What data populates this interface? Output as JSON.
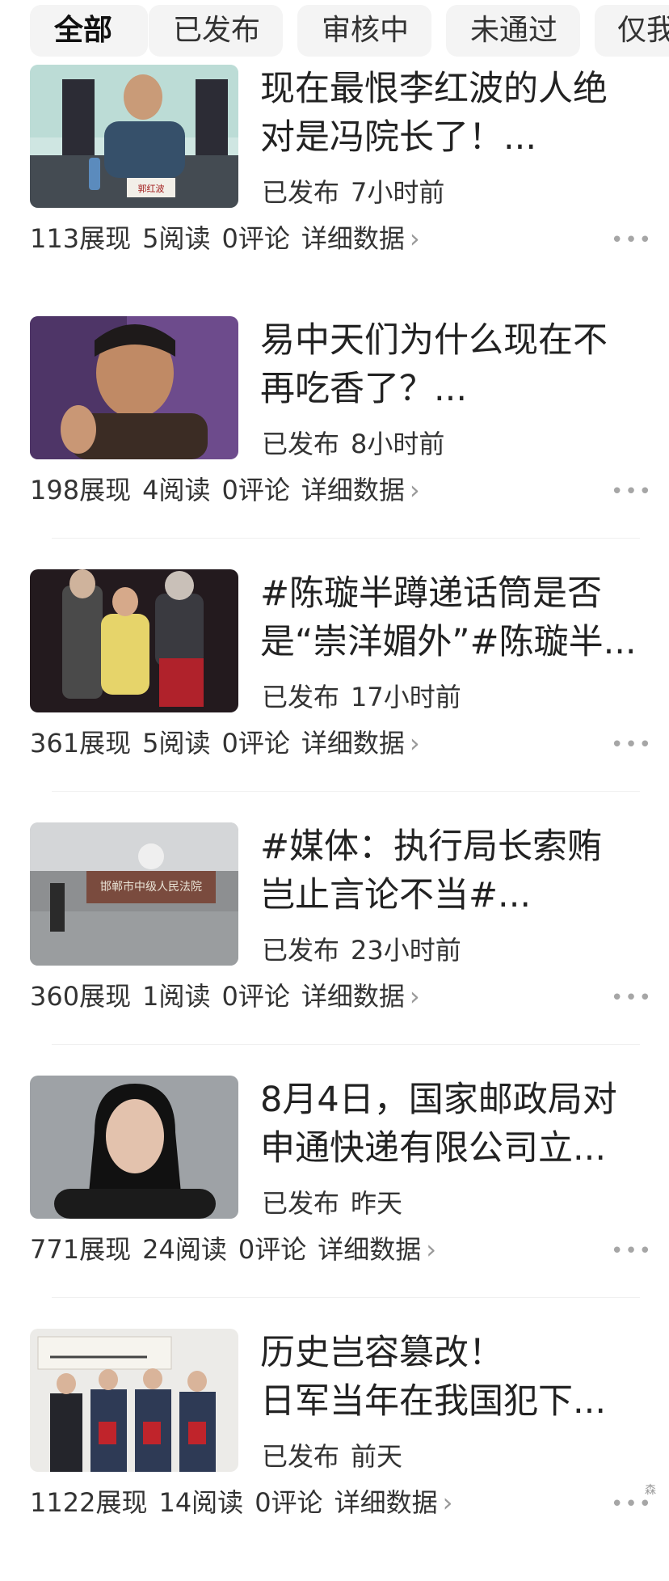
{
  "tabs": [
    "全部",
    "已发布",
    "审核中",
    "未通过",
    "仅我可见"
  ],
  "articles": [
    {
      "title_line1": "现在最恨李红波的人绝",
      "title_line2": "对是冯院长了！...",
      "status": "已发布",
      "time": "7小时前",
      "views": "113展现",
      "reads": "5阅读",
      "comments": "0评论",
      "detail": "详细数据",
      "chevron": "›",
      "more": "•••",
      "thumb_text": "郭红波"
    },
    {
      "title_line1": "易中天们为什么现在不",
      "title_line2": "再吃香了？...",
      "status": "已发布",
      "time": "8小时前",
      "views": "198展现",
      "reads": "4阅读",
      "comments": "0评论",
      "detail": "详细数据",
      "chevron": "›",
      "more": "•••"
    },
    {
      "title_line1": "#陈璇半蹲递话筒是否",
      "title_line2": "是“崇洋媚外”#陈璇半...",
      "status": "已发布",
      "time": "17小时前",
      "views": "361展现",
      "reads": "5阅读",
      "comments": "0评论",
      "detail": "详细数据",
      "chevron": "›",
      "more": "•••"
    },
    {
      "title_line1": "#媒体：执行局长索贿",
      "title_line2": "岂止言论不当#...",
      "status": "已发布",
      "time": "23小时前",
      "views": "360展现",
      "reads": "1阅读",
      "comments": "0评论",
      "detail": "详细数据",
      "chevron": "›",
      "more": "•••",
      "thumb_text": "邯郸市中级人民法院"
    },
    {
      "title_line1": "8月4日，国家邮政局对",
      "title_line2": "申通快递有限公司立...",
      "status": "已发布",
      "time": "昨天",
      "views": "771展现",
      "reads": "24阅读",
      "comments": "0评论",
      "detail": "详细数据",
      "chevron": "›",
      "more": "•••"
    },
    {
      "title_line1": "历史岂容篡改！",
      "title_line2": "日军当年在我国犯下...",
      "status": "已发布",
      "time": "前天",
      "views": "1122展现",
      "reads": "14阅读",
      "comments": "0评论",
      "detail": "详细数据",
      "chevron": "›",
      "more": "•••"
    }
  ],
  "corner_mark": "森",
  "colors": {
    "tab_bg": "#f4f4f4",
    "text": "#222222",
    "muted": "#999999",
    "divider": "#f0f0f0"
  }
}
